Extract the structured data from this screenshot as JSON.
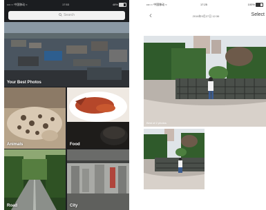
{
  "left_screen": {
    "status_bar": {
      "carrier": "•••○○ 中国移动 ≈",
      "time": "17:53",
      "battery": "48%"
    },
    "search": {
      "placeholder": "Search"
    },
    "tiles": [
      {
        "key": "best",
        "label": "Your Best Photos"
      },
      {
        "key": "animals",
        "label": "Animals"
      },
      {
        "key": "food",
        "label": "Food"
      },
      {
        "key": "road",
        "label": "Road"
      },
      {
        "key": "city",
        "label": "City"
      }
    ]
  },
  "right_screen": {
    "status_bar": {
      "carrier": "•••○○ 中国移动 ≈",
      "time": "17:25",
      "battery": "100%"
    },
    "back_icon": "chevron-left-icon",
    "date_title": "2016年9月27日 12:36",
    "select_label": "Select",
    "photo_caption": "Best of 2 photos"
  },
  "colors": {
    "dark_bg": "#1b1d20",
    "search_bg": "#f2f2f2"
  }
}
